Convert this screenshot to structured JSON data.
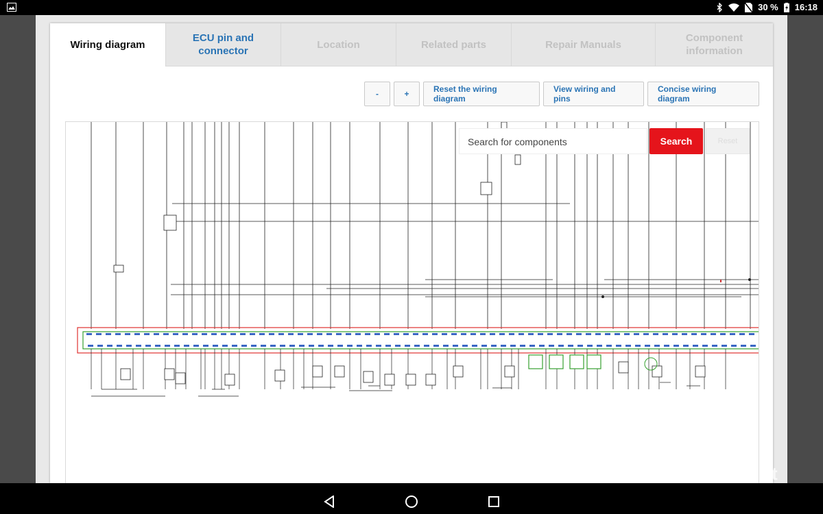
{
  "status": {
    "battery": "30 %",
    "time": "16:18"
  },
  "tabs": [
    {
      "label": "Wiring diagram",
      "state": "active"
    },
    {
      "label": "ECU pin and connector",
      "state": "link"
    },
    {
      "label": "Location",
      "state": "disabled"
    },
    {
      "label": "Related parts",
      "state": "disabled"
    },
    {
      "label": "Repair Manuals",
      "state": "disabled"
    },
    {
      "label": "Component information",
      "state": "disabled"
    }
  ],
  "toolbar": {
    "zoom_out": "-",
    "zoom_in": "+",
    "reset_diagram": "Reset the wiring diagram",
    "view_wiring_pins": "View wiring and pins",
    "concise": "Concise wiring diagram"
  },
  "search": {
    "placeholder": "Search for components",
    "button": "Search",
    "reset": "Reset"
  },
  "watermark": "skelbiu.lt",
  "colors": {
    "accent": "#2a74b5",
    "search_red": "#e5141b",
    "connector_green": "#35a12e",
    "highlight_red": "#e0312f"
  }
}
